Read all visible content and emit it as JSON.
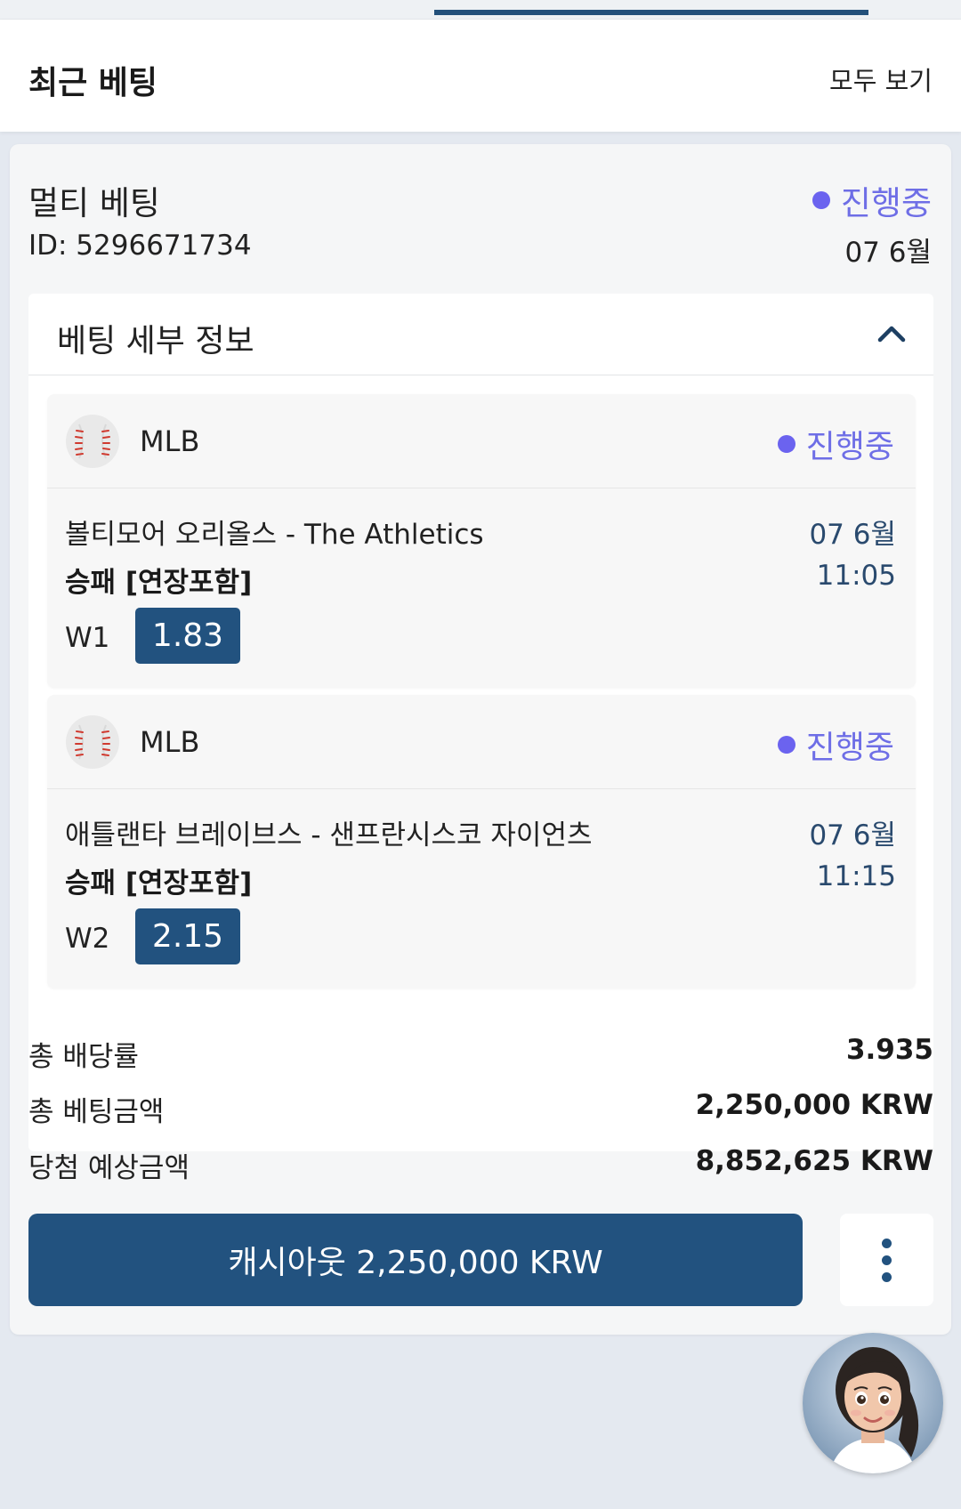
{
  "header": {
    "title": "최근 베팅",
    "view_all": "모두 보기"
  },
  "bet": {
    "type": "멀티 베팅",
    "id_label": "ID: 5296671734",
    "status": "진행중",
    "date": "07 6월",
    "details_title": "베팅 세부 정보",
    "selections": [
      {
        "league": "MLB",
        "status": "진행중",
        "match": "볼티모어 오리올스 - The Athletics",
        "market": "승패 [연장포함]",
        "pick": "W1",
        "odds": "1.83",
        "date": "07 6월",
        "time": "11:05"
      },
      {
        "league": "MLB",
        "status": "진행중",
        "match": "애틀랜타 브레이브스 - 샌프란시스코 자이언츠",
        "market": "승패 [연장포함]",
        "pick": "W2",
        "odds": "2.15",
        "date": "07 6월",
        "time": "11:15"
      }
    ],
    "summary": [
      {
        "label": "총 배당률",
        "value": "3.935"
      },
      {
        "label": "총 베팅금액",
        "value": "2,250,000 KRW"
      },
      {
        "label": "당첨 예상금액",
        "value": "8,852,625 KRW"
      }
    ],
    "cashout_label": "캐시아웃 2,250,000 KRW"
  },
  "icons": {
    "sport": "baseball-icon",
    "collapse": "chevron-up-icon",
    "more": "more-vertical-icon",
    "assistant": "assistant-avatar"
  },
  "colors": {
    "primary": "#22527f",
    "status": "#6e6ee6",
    "background": "#e4e9f0"
  }
}
